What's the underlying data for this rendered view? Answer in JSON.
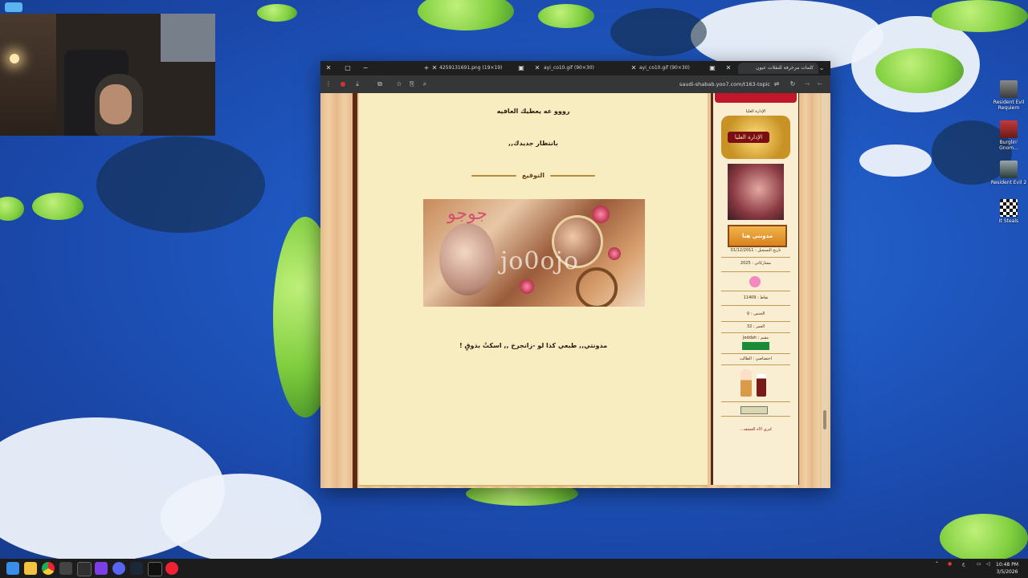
{
  "tabs": [
    {
      "label": "4259131691.png (19×19)"
    },
    {
      "label": "ayi_co10.gif (90×30)"
    },
    {
      "label": "ayi_co10.gif (90×30)"
    },
    {
      "label": "كلمات مزخرفة للنقلات عيون"
    }
  ],
  "address": {
    "url": "saudi-shabab.yoo7.com/t163-topic"
  },
  "post": {
    "line1": "رووو عه يعطيك العافيه",
    "line2": "بانتظار جديدك,,",
    "signature_title": "التوقيع",
    "banner_text": "jo0ojo",
    "banner_arabic": "جوجو",
    "line3": "مدونتي,, طبعي كذا لو -زانجرخ ,, اسكتُ بذوقٍ !"
  },
  "sidebar": {
    "rank_header": "الإدارة العليا",
    "rank_label": "الإدارة العليا",
    "blog_button": "مدونتي هنا",
    "reg_date": "تاريخ التسجيل : 01/12/2011",
    "posts": "مشاركاتي : 2025",
    "points": "نقاط : 11409",
    "gender": "الجنس : ♀",
    "age": "العمر : 32",
    "location": "مقيم : Jeddah",
    "job": "اختصاصي : الطالب",
    "quote": "كبري الآه العشقه..."
  },
  "desktop_icons": [
    {
      "label": "Resident Evil Requiem"
    },
    {
      "label": "Burglin' Gnom..."
    },
    {
      "label": "Resident Evil 2"
    },
    {
      "label": "It Steals"
    }
  ],
  "clock": {
    "time": "10:48 PM",
    "date": "3/5/2026"
  },
  "colors": {
    "post_bg": "#f7edc1",
    "frame": "#5b2a14",
    "accent_red": "#c0182a"
  }
}
